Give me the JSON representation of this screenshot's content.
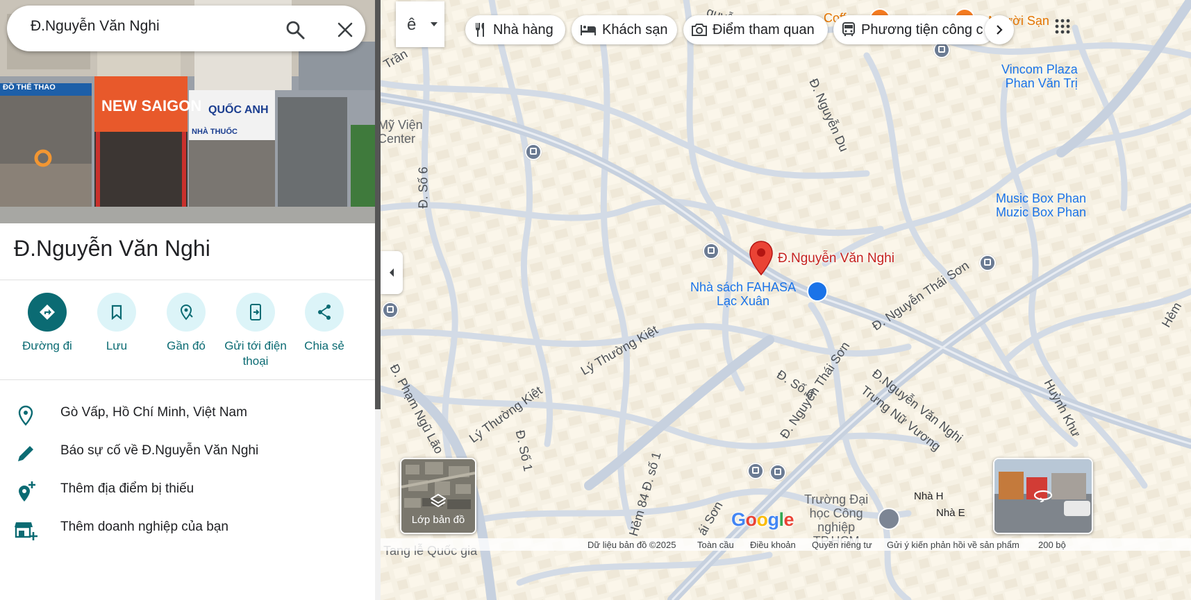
{
  "search": {
    "value": "Đ.Nguyễn Văn Nghi"
  },
  "photo": {
    "sign_left": "NEW SAIGON",
    "sign_mid": "QUỐC ANH",
    "sign_mid_sub": "NHÀ THUỐC",
    "sign_far_left": "ĐỒ THỂ THAO"
  },
  "place": {
    "title": "Đ.Nguyễn Văn Nghi"
  },
  "actions": [
    {
      "label": "Đường đi",
      "icon": "directions-icon"
    },
    {
      "label": "Lưu",
      "icon": "bookmark-icon"
    },
    {
      "label": "Gần đó",
      "icon": "nearby-icon"
    },
    {
      "label": "Gửi tới điện thoại",
      "icon": "send-to-phone-icon"
    },
    {
      "label": "Chia sẻ",
      "icon": "share-icon"
    }
  ],
  "info": [
    {
      "text": "Gò Vấp, Hồ Chí Minh, Việt Nam",
      "icon": "location-pin-icon"
    },
    {
      "text": "Báo sự cố về Đ.Nguyễn Văn Nghi",
      "icon": "pencil-icon"
    },
    {
      "text": "Thêm địa điểm bị thiếu",
      "icon": "add-place-icon"
    },
    {
      "text": "Thêm doanh nghiệp của bạn",
      "icon": "add-business-icon"
    }
  ],
  "ime": {
    "label": "ê"
  },
  "chips": [
    {
      "label": "Nhà hàng",
      "icon": "restaurant-icon"
    },
    {
      "label": "Khách sạn",
      "icon": "hotel-icon"
    },
    {
      "label": "Điểm tham quan",
      "icon": "camera-icon"
    },
    {
      "label": "Phương tiện công c",
      "icon": "transit-icon"
    }
  ],
  "map": {
    "selected_label": "Đ.Nguyễn Văn Nghi",
    "poi_fahasa_1": "Nhà sách FAHASA",
    "poi_fahasa_2": "Lạc Xuân",
    "poi_vincom_1": "Vincom Plaza",
    "poi_vincom_2": "Phan Văn Trị",
    "poi_music_1": "Music Box Phan",
    "poi_music_2": "Muzic Box Phan",
    "poi_myvien_1": "Mỹ Viện",
    "poi_myvien_2": "Center",
    "poi_truong_1": "Trường Đại",
    "poi_truong_2": "học Công",
    "poi_truong_3": "nghiệp",
    "poi_truong_4": "TP.HCM",
    "poi_coffee": "Coffe",
    "poi_nguoi": "g Người Sạn",
    "nha_h": "Nhà H",
    "nha_e": "Nhà E",
    "roads": {
      "tran": "Trần",
      "nguyen_du": "Đ. Nguyễn Du",
      "nguyen_du_top": "guyễn D",
      "so6_left": "Đ. Số 6",
      "so6_right": "Đ. Số 6",
      "pham_ngu_lao": "Đ. Phạm Ngũ Lão",
      "ly_thuong_kiet_1": "Lý Thường Kiệt",
      "ly_thuong_kiet_2": "Lý Thường Kiệt",
      "so1": "Đ. Số 1",
      "hem84": "Hẻm 84 Đ. số 1",
      "nguyen_thai_son_1": "Đ. Nguyễn Thái Sơn",
      "nguyen_thai_son_2": "Đ. Nguyễn Thái Sơn",
      "nguyen_van_nghi": "Đ.Nguyễn Văn Nghi",
      "trung_nu_vuong": "Trưng Nữ Vương",
      "huynh_khuong": "Huỳnh Khư",
      "hem": "Hẻm",
      "thai_son": "ái Sơn",
      "tang_le": "Tang lễ Quốc gia"
    }
  },
  "layers": {
    "label": "Lớp bản đồ"
  },
  "brand": "Google",
  "footer": {
    "data": "Dữ liệu bản đồ ©2025",
    "global": "Toàn cầu",
    "terms": "Điều khoản",
    "privacy": "Quyền riêng tư",
    "feedback": "Gửi ý kiến phản hồi về sản phẩm",
    "scale": "200 bộ"
  },
  "colors": {
    "accent": "#0b6b73",
    "accent_light": "#dcf4f8",
    "marker": "#d93025",
    "poi_blue": "#1a73e8"
  }
}
